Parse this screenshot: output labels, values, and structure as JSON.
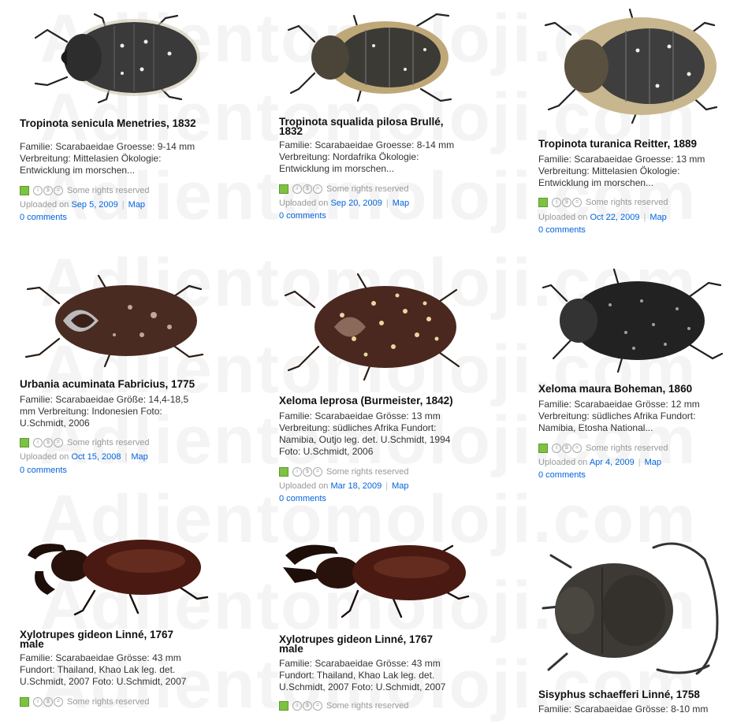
{
  "watermark": "Adlientomoloji.com",
  "license_text": "Some rights reserved",
  "uploaded_prefix": "Uploaded on",
  "map_label": "Map",
  "comments_label": "0 comments",
  "cards": [
    {
      "title": "Tropinota senicula Menetries, 1832",
      "description": "Familie: Scarabaeidae Groesse: 9-14 mm Verbreitung: Mittelasien Ökologie: Entwicklung im morschen...",
      "date": "Sep 5, 2009"
    },
    {
      "title": "Tropinota squalida pilosa Brullé, 1832",
      "description": "Familie: Scarabaeidae Groesse: 8-14 mm Verbreitung: Nordafrika Ökologie: Entwicklung im morschen...",
      "date": "Sep 20, 2009"
    },
    {
      "title": "Tropinota turanica Reitter, 1889",
      "description": "Familie: Scarabaeidae Groesse: 13 mm Verbreitung: Mittelasien Ökologie: Entwicklung im morschen...",
      "date": "Oct 22, 2009"
    },
    {
      "title": "Urbania acuminata Fabricius, 1775",
      "description": "Familie: Scarabaeidae Größe: 14,4-18,5 mm Verbreitung: Indonesien Foto: U.Schmidt, 2006",
      "date": "Oct 15, 2008"
    },
    {
      "title": "Xeloma leprosa (Burmeister, 1842)",
      "description": "Familie: Scarabaeidae Grösse: 13 mm Verbreitung: südliches Afrika Fundort: Namibia, Outjo leg. det. U.Schmidt, 1994 Foto: U.Schmidt, 2006",
      "date": "Mar 18, 2009"
    },
    {
      "title": "Xeloma maura Boheman, 1860",
      "description": "Familie: Scarabaeidae Grösse: 12 mm Verbreitung: südliches Afrika Fundort: Namibia, Etosha National...",
      "date": "Apr 4, 2009"
    },
    {
      "title": "Xylotrupes gideon Linné, 1767 male",
      "description": "Familie: Scarabaeidae Grösse: 43 mm Fundort: Thailand, Khao Lak leg. det. U.Schmidt, 2007 Foto: U.Schmidt, 2007",
      "date": ""
    },
    {
      "title": "Xylotrupes gideon Linné, 1767 male",
      "description": "Familie: Scarabaeidae Grösse: 43 mm Fundort: Thailand, Khao Lak leg. det. U.Schmidt, 2007 Foto: U.Schmidt, 2007",
      "date": ""
    },
    {
      "title": "Sisyphus schaefferi Linné, 1758",
      "description": "Familie: Scarabaeidae Grösse: 8-10 mm",
      "date": ""
    }
  ]
}
